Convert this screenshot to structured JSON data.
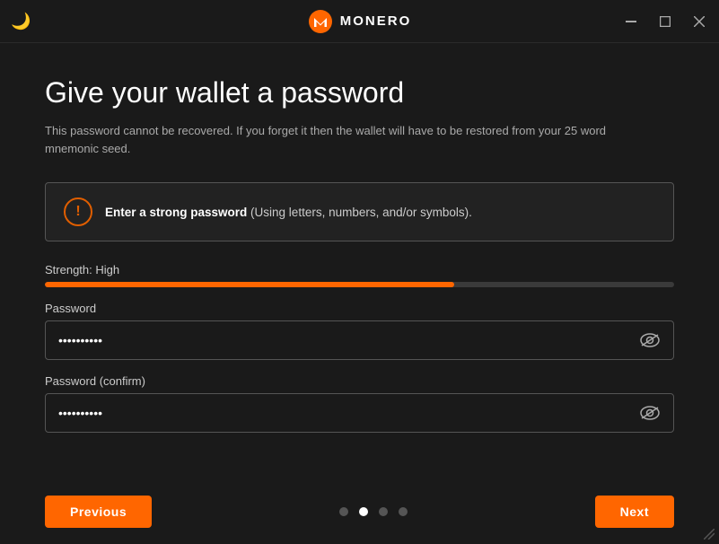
{
  "titleBar": {
    "title": "MONERO",
    "minimizeLabel": "minimize",
    "maximizeLabel": "maximize",
    "closeLabel": "close"
  },
  "page": {
    "title": "Give your wallet a password",
    "subtitle": "This password cannot be recovered. If you forget it then the wallet will have to be restored from your 25 word mnemonic seed.",
    "alert": {
      "boldText": "Enter a strong password",
      "regularText": " (Using letters, numbers, and/or symbols)."
    },
    "strength": {
      "label": "Strength: High",
      "fillPercent": 65
    },
    "passwordField": {
      "label": "Password",
      "placeholder": "••••••••••"
    },
    "confirmField": {
      "label": "Password (confirm)",
      "placeholder": "••••••••••"
    }
  },
  "navigation": {
    "previousLabel": "Previous",
    "nextLabel": "Next",
    "dots": [
      {
        "active": false
      },
      {
        "active": true
      },
      {
        "active": false
      },
      {
        "active": false
      }
    ]
  }
}
